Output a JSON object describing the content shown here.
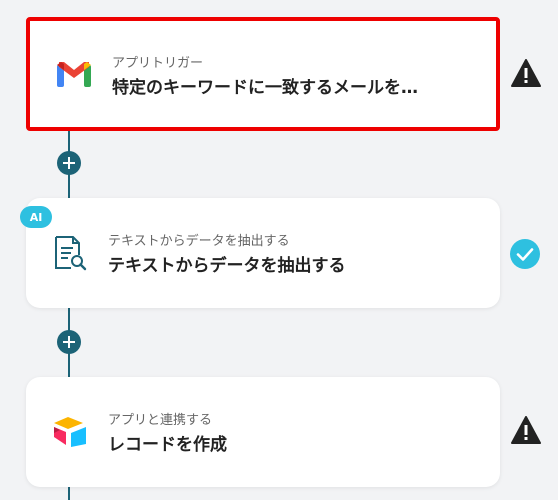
{
  "steps": [
    {
      "subtitle": "アプリトリガー",
      "title": "特定のキーワードに一致するメールを…",
      "icon": "gmail-icon",
      "status": "warning-icon",
      "selected": true
    },
    {
      "subtitle": "テキストからデータを抽出する",
      "title": "テキストからデータを抽出する",
      "icon": "document-search-icon",
      "badge": "AI",
      "status": "check-icon"
    },
    {
      "subtitle": "アプリと連携する",
      "title": "レコードを作成",
      "icon": "airtable-icon",
      "status": "warning-icon"
    }
  ],
  "colors": {
    "accent": "#1c6377",
    "ai_badge": "#2ec0e0",
    "check": "#2ec0e0",
    "selected_border": "#ee0000",
    "warning": "#222222"
  }
}
